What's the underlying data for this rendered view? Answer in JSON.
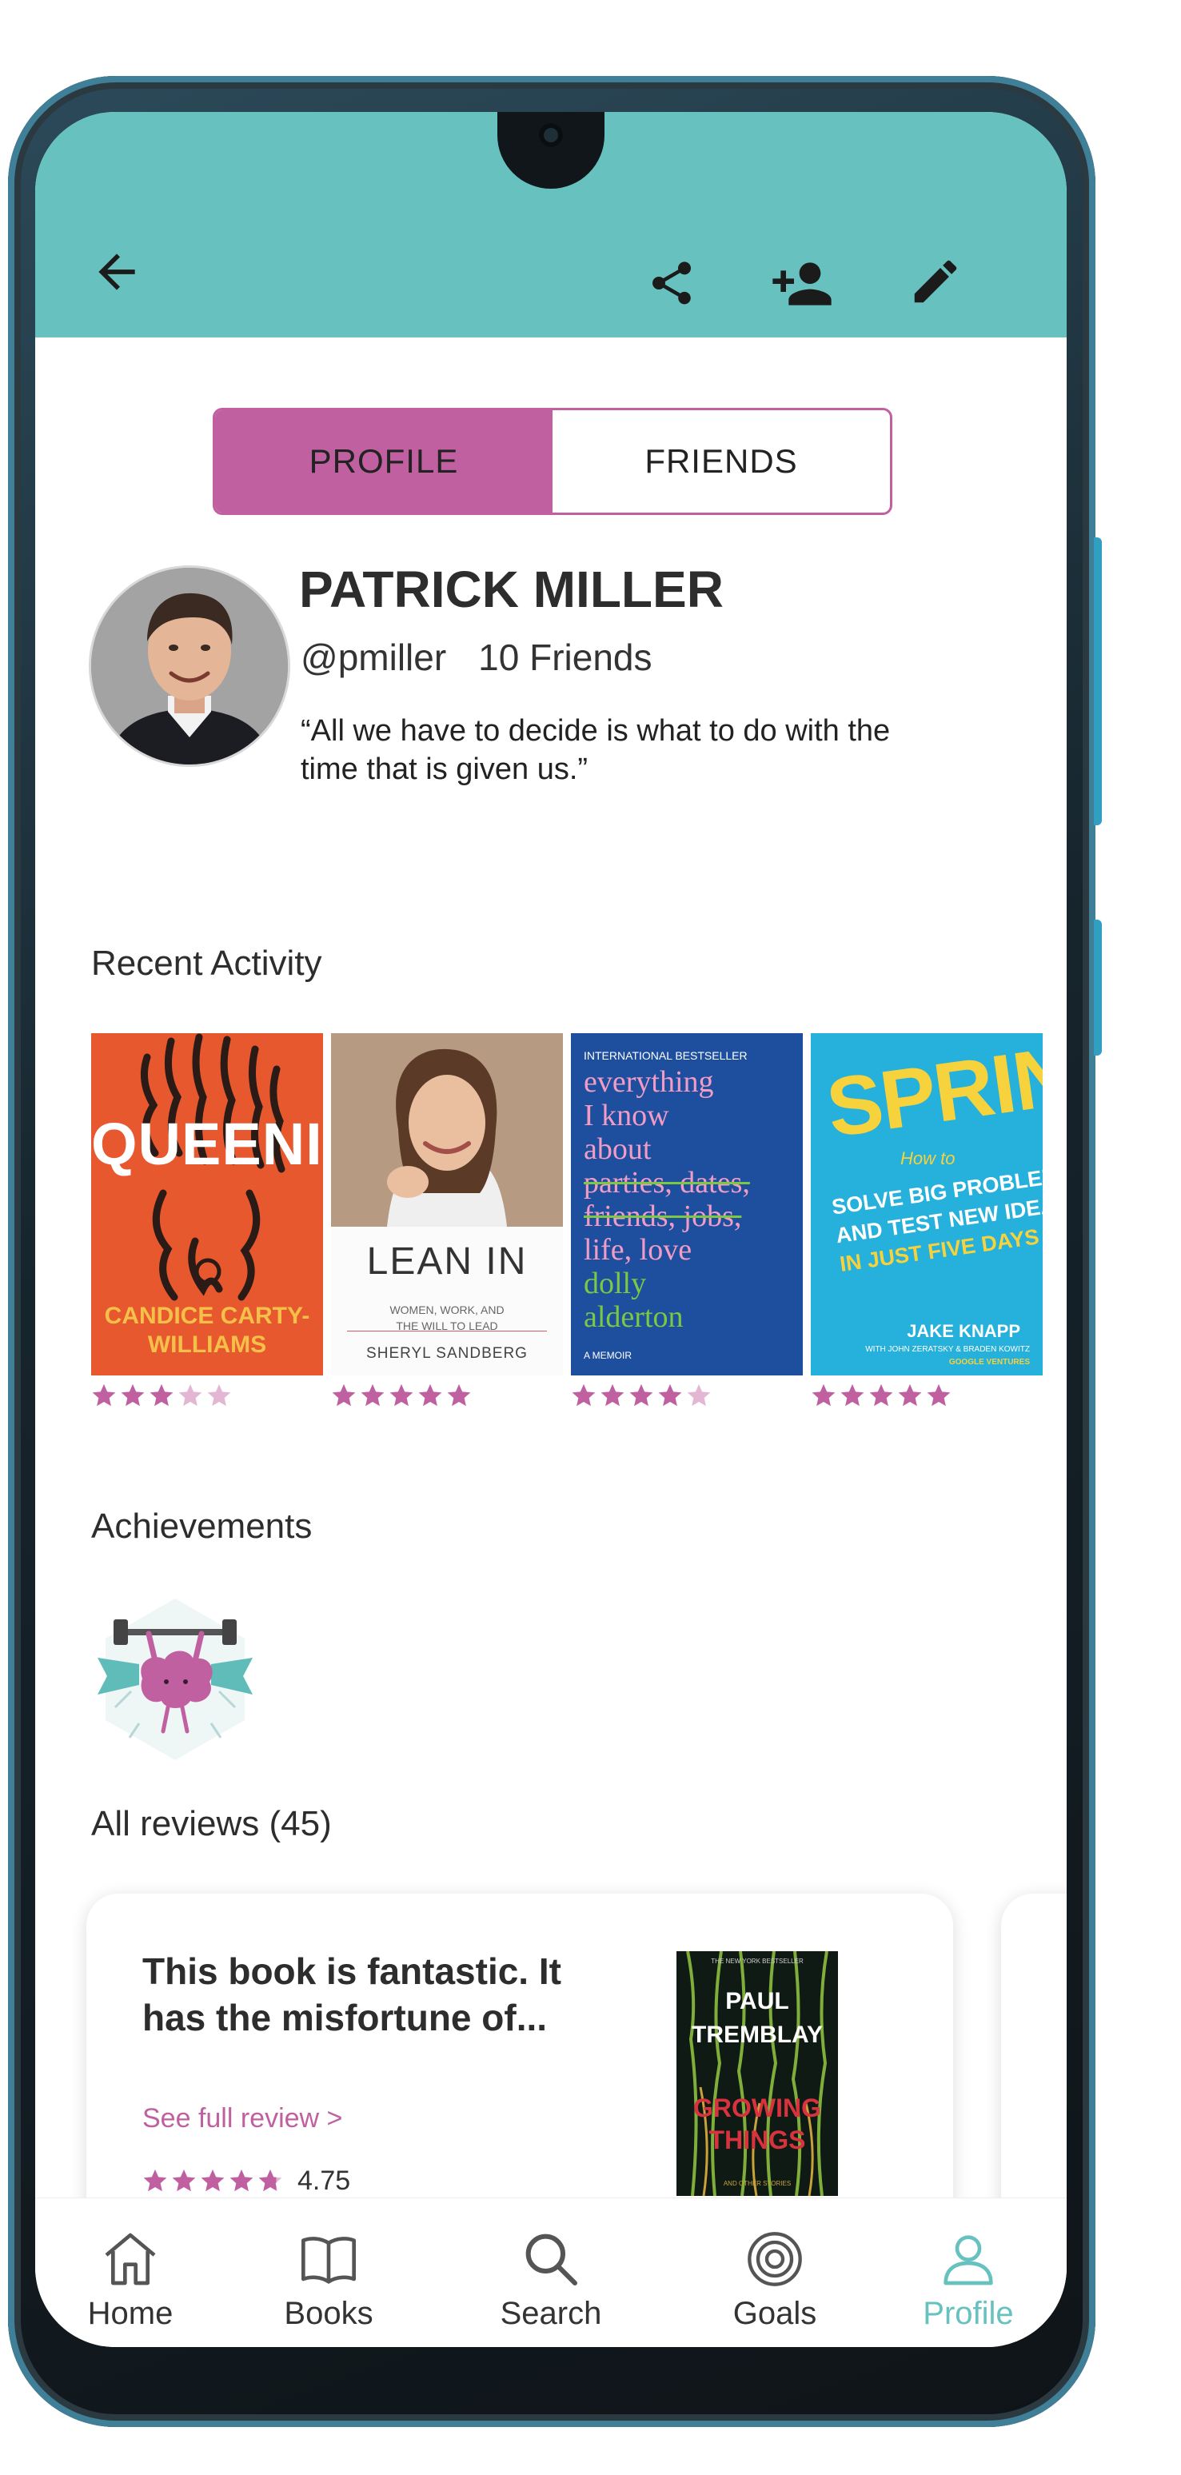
{
  "header": {
    "back_icon": "arrow-left-icon",
    "share_icon": "share-icon",
    "add_friend_icon": "person-add-icon",
    "edit_icon": "pencil-icon"
  },
  "tabs": [
    {
      "label": "PROFILE",
      "active": true
    },
    {
      "label": "FRIENDS",
      "active": false
    }
  ],
  "profile": {
    "name": "PATRICK MILLER",
    "handle": "@pmiller",
    "friends": "10 Friends",
    "quote": "“All we have to decide is what to do with the time that is given us.”"
  },
  "recent_activity": {
    "title": "Recent Activity",
    "books": [
      {
        "title": "QUEENIE",
        "author": "CANDICE CARTY-WILLIAMS",
        "rating": 3
      },
      {
        "title": "LEAN IN",
        "subtitle": "WOMEN, WORK, AND THE WILL TO LEAD",
        "author": "SHERYL SANDBERG",
        "rating": 5
      },
      {
        "banner": "INTERNATIONAL BESTSELLER",
        "title_lines": [
          "everything",
          "I know",
          "about",
          "parties, dates,",
          "friends, jobs,",
          "life, love"
        ],
        "author_lines": [
          "dolly",
          "alderton"
        ],
        "footer": "A MEMOIR",
        "rating": 4
      },
      {
        "kicker": "How to",
        "title": "SPRINT",
        "tagline_lines": [
          "SOLVE BIG PROBLEMS",
          "AND TEST NEW IDEAS",
          "IN JUST FIVE DAYS"
        ],
        "author": "JAKE KNAPP",
        "coauthors": "WITH JOHN ZERATSKY & BRADEN KOWITZ",
        "publisher": "GOOGLE VENTURES",
        "rating": 5
      }
    ]
  },
  "achievements": {
    "title": "Achievements",
    "badges": [
      {
        "icon": "brain-lifting-barbell-icon"
      }
    ]
  },
  "reviews": {
    "title": "All reviews (45)",
    "items": [
      {
        "excerpt": "This book is fantastic. It has the misfortune of...",
        "link": "See full review >",
        "rating": "4.75",
        "stars": 4.75,
        "book": {
          "top_line": "THE NEW YORK BESTSELLER",
          "author_first": "PAUL",
          "author_last": "TREMBLAY",
          "title_lines": [
            "GROWING",
            "THINGS"
          ],
          "tagline": "AND OTHER STORIES"
        }
      }
    ]
  },
  "nav": [
    {
      "label": "Home",
      "icon": "home-icon",
      "active": false
    },
    {
      "label": "Books",
      "icon": "book-open-icon",
      "active": false
    },
    {
      "label": "Search",
      "icon": "search-icon",
      "active": false
    },
    {
      "label": "Goals",
      "icon": "target-icon",
      "active": false
    },
    {
      "label": "Profile",
      "icon": "person-icon",
      "active": true
    }
  ],
  "colors": {
    "accent_teal": "#66c1bf",
    "accent_magenta": "#c060a1",
    "star_filled": "#c060a1",
    "star_empty": "#e3b7d4"
  }
}
